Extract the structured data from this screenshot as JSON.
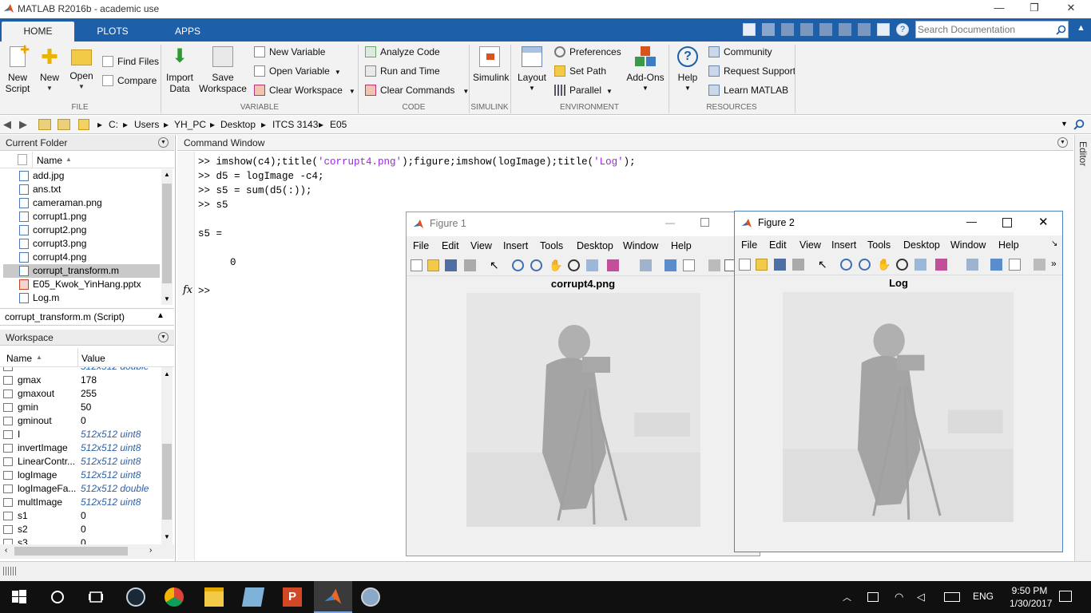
{
  "app": {
    "title": "MATLAB R2016b - academic use",
    "window_controls": [
      "—",
      "❐",
      "✕"
    ]
  },
  "tabs": [
    "HOME",
    "PLOTS",
    "APPS"
  ],
  "search": {
    "placeholder": "Search Documentation"
  },
  "ribbon": {
    "file": {
      "new_script": [
        "New",
        "Script"
      ],
      "new": "New",
      "open": "Open",
      "find_files": "Find Files",
      "compare": "Compare",
      "group": "FILE"
    },
    "variable": {
      "import_data": [
        "Import",
        "Data"
      ],
      "save_workspace": [
        "Save",
        "Workspace"
      ],
      "new_variable": "New Variable",
      "open_variable": "Open Variable",
      "clear_workspace": "Clear Workspace",
      "group": "VARIABLE"
    },
    "code": {
      "analyze_code": "Analyze Code",
      "run_and_time": "Run and Time",
      "clear_commands": "Clear Commands",
      "group": "CODE"
    },
    "simulink": {
      "simulink": "Simulink",
      "group": "SIMULINK"
    },
    "environment": {
      "layout": "Layout",
      "preferences": "Preferences",
      "set_path": "Set Path",
      "parallel": "Parallel",
      "add_ons": "Add-Ons",
      "group": "ENVIRONMENT"
    },
    "resources": {
      "help": "Help",
      "community": "Community",
      "request_support": "Request Support",
      "learn_matlab": "Learn MATLAB",
      "group": "RESOURCES"
    }
  },
  "address": {
    "crumbs": [
      "C:",
      "Users",
      "YH_PC",
      "Desktop",
      "ITCS 3143",
      "E05"
    ]
  },
  "current_folder": {
    "title": "Current Folder",
    "column": "Name",
    "files": [
      "add.jpg",
      "ans.txt",
      "cameraman.png",
      "corrupt1.png",
      "corrupt2.png",
      "corrupt3.png",
      "corrupt4.png",
      "corrupt_transform.m",
      "E05_Kwok_YinHang.pptx",
      "Log.m"
    ],
    "details": "corrupt_transform.m  (Script)"
  },
  "workspace": {
    "title": "Workspace",
    "columns": [
      "Name",
      "Value"
    ],
    "partial_top_value": "512x512 double",
    "rows": [
      {
        "name": "gmax",
        "value": "178",
        "italic": false
      },
      {
        "name": "gmaxout",
        "value": "255",
        "italic": false
      },
      {
        "name": "gmin",
        "value": "50",
        "italic": false
      },
      {
        "name": "gminout",
        "value": "0",
        "italic": false
      },
      {
        "name": "I",
        "value": "512x512 uint8",
        "italic": true
      },
      {
        "name": "invertImage",
        "value": "512x512 uint8",
        "italic": true
      },
      {
        "name": "LinearContr...",
        "value": "512x512 uint8",
        "italic": true
      },
      {
        "name": "logImage",
        "value": "512x512 uint8",
        "italic": true
      },
      {
        "name": "logImageFa...",
        "value": "512x512 double",
        "italic": true
      },
      {
        "name": "multImage",
        "value": "512x512 uint8",
        "italic": true
      },
      {
        "name": "s1",
        "value": "0",
        "italic": false
      },
      {
        "name": "s2",
        "value": "0",
        "italic": false
      },
      {
        "name": "s3",
        "value": "0",
        "italic": false
      }
    ]
  },
  "command_window": {
    "title": "Command Window",
    "side_tab": "Editor",
    "line1_a": ">> imshow(c4);title(",
    "line1_s1": "'corrupt4.png'",
    "line1_b": ");figure;imshow(logImage);title(",
    "line1_s2": "'Log'",
    "line1_c": ");",
    "line2": ">> d5 = logImage -c4;",
    "line3": ">> s5 = sum(d5(:));",
    "line4": ">> s5",
    "line5": "s5 =",
    "line6": "0",
    "prompt": ">>",
    "fx": "fx"
  },
  "figure1": {
    "title": "Figure 1",
    "menu": [
      "File",
      "Edit",
      "View",
      "Insert",
      "Tools",
      "Desktop",
      "Window",
      "Help"
    ],
    "image_title": "corrupt4.png"
  },
  "figure2": {
    "title": "Figure 2",
    "menu": [
      "File",
      "Edit",
      "View",
      "Insert",
      "Tools",
      "Desktop",
      "Window",
      "Help"
    ],
    "image_title": "Log"
  },
  "taskbar": {
    "time": "9:50 PM",
    "date": "1/30/2017",
    "lang": "ENG"
  },
  "colors": {
    "tab_blue": "#1d5fa8",
    "ribbon_bg": "#f2f2f2",
    "string_purple": "#a020f0",
    "taskbar": "#101010"
  }
}
